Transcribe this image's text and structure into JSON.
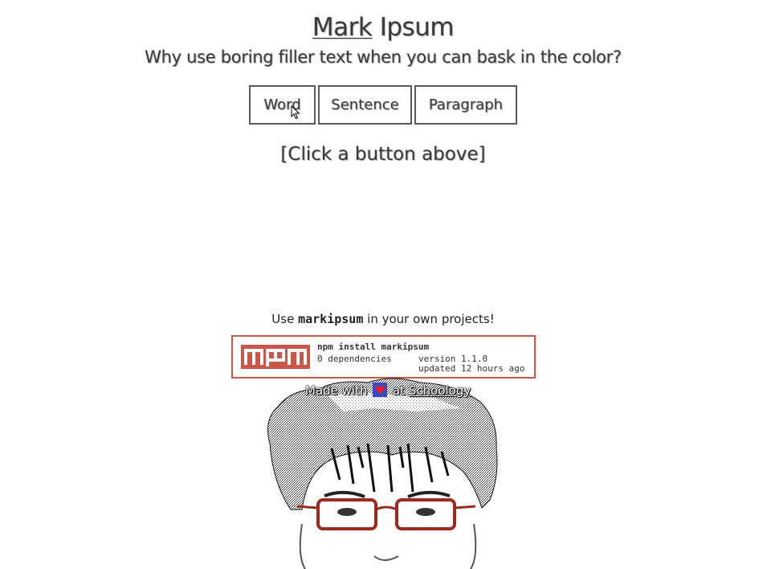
{
  "header": {
    "title_link": "Mark",
    "title_rest": "Ipsum",
    "subtitle": "Why use boring filler text when you can bask in the color?"
  },
  "buttons": {
    "word": "Word",
    "sentence": "Sentence",
    "paragraph": "Paragraph"
  },
  "output": {
    "placeholder": "[Click a button above]"
  },
  "usage": {
    "prefix": "Use",
    "package": "markipsum",
    "suffix": "in your own projects!"
  },
  "npm_badge": {
    "logo": "npm",
    "command": "npm install markipsum",
    "dependencies": "0 dependencies",
    "version": "version 1.1.0",
    "updated": "updated 12 hours ago",
    "accent_color": "#c9574a"
  },
  "footer": {
    "made_with": "Made with",
    "heart_icon": "heart-icon",
    "at": "at",
    "org": "Schoology"
  }
}
